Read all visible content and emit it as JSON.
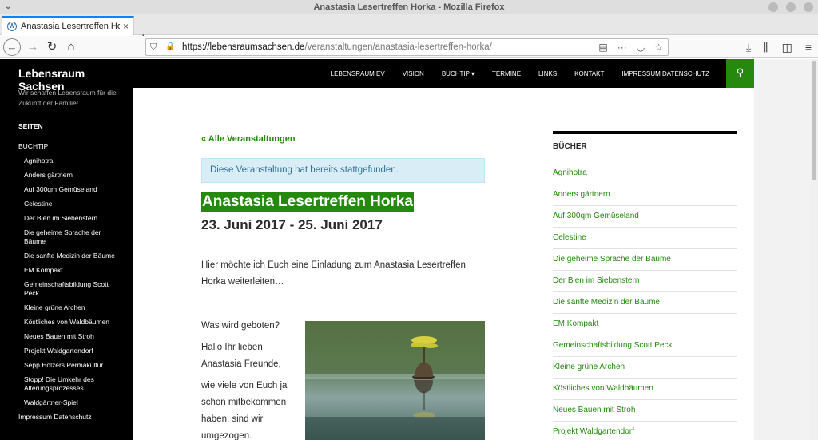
{
  "window": {
    "title": "Anastasia Lesertreffen Horka - Mozilla Firefox"
  },
  "tab": {
    "title": "Anastasia Lesertreffen Horka",
    "close": "×",
    "new_tab": "+"
  },
  "url": {
    "host": "https://lebensraumsachsen.de",
    "path": "/veranstaltungen/anastasia-lesertreffen-horka/"
  },
  "site": {
    "title": "Lebensraum Sachsen",
    "description": "Wir schaffen Lebensraum für die Zukunft der Familie!"
  },
  "sidebar": {
    "heading": "SEITEN",
    "items": [
      {
        "label": "BUCHTIP",
        "level": "top"
      },
      {
        "label": "Agnihotra",
        "level": "sub"
      },
      {
        "label": "Anders gärtnern",
        "level": "sub"
      },
      {
        "label": "Auf 300qm Gemüseland",
        "level": "sub"
      },
      {
        "label": "Celestine",
        "level": "sub"
      },
      {
        "label": "Der Bien im Siebenstern",
        "level": "sub"
      },
      {
        "label": "Die geheime Sprache der Bäume",
        "level": "sub"
      },
      {
        "label": "Die sanfte Medizin der Bäume",
        "level": "sub"
      },
      {
        "label": "EM Kompakt",
        "level": "sub"
      },
      {
        "label": "Gemeinschaftsbildung Scott Peck",
        "level": "sub"
      },
      {
        "label": "Kleine grüne Archen",
        "level": "sub"
      },
      {
        "label": "Köstliches von Waldbäumen",
        "level": "sub"
      },
      {
        "label": "Neues Bauen mit Stroh",
        "level": "sub"
      },
      {
        "label": "Projekt Waldgartendorf",
        "level": "sub"
      },
      {
        "label": "Sepp Holzers Permakultur",
        "level": "sub"
      },
      {
        "label": "Stopp! Die Umkehr des Alterungsprozesses",
        "level": "sub"
      },
      {
        "label": "Waldgärtner-Spiel",
        "level": "sub"
      },
      {
        "label": "Impressum Datenschutz",
        "level": "top"
      }
    ]
  },
  "topnav": {
    "items": [
      "LEBENSRAUM EV",
      "VISION",
      "BUCHTIP ▾",
      "TERMINE",
      "LINKS",
      "KONTAKT",
      "IMPRESSUM DATENSCHUTZ"
    ]
  },
  "event": {
    "back_link": "« Alle Veranstaltungen",
    "notice": "Diese Veranstaltung hat bereits stattgefunden.",
    "title": "Anastasia Lesertreffen Horka",
    "date": "23. Juni 2017 - 25. Juni 2017",
    "intro": "Hier möchte ich Euch eine Einladung zum Anastasia Lesertreffen Horka weiterleiten…",
    "paragraphs": [
      "Was wird geboten?",
      "Hallo Ihr lieben Anastasia Freunde,",
      "wie viele von Euch ja schon mitbekommen haben, sind wir umgezogen."
    ]
  },
  "widget": {
    "title": "BÜCHER",
    "items": [
      "Agnihotra",
      "Anders gärtnern",
      "Auf 300qm Gemüseland",
      "Celestine",
      "Die geheime Sprache der Bäume",
      "Der Bien im Siebenstern",
      "Die sanfte Medizin der Bäume",
      "EM Kompakt",
      "Gemeinschaftsbildung Scott Peck",
      "Kleine grüne Archen",
      "Köstliches von Waldbäumen",
      "Neues Bauen mit Stroh",
      "Projekt Waldgartendorf"
    ]
  },
  "colors": {
    "accent_green": "#24890d",
    "sidebar_bg": "#000000",
    "notice_bg": "#d9edf7"
  }
}
